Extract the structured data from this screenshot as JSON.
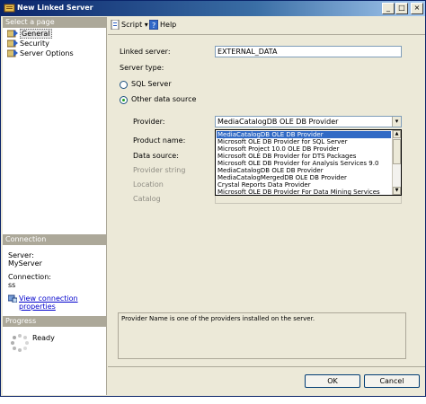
{
  "window": {
    "title": "New Linked Server",
    "controls": {
      "minimize": "_",
      "maximize": "□",
      "close": "×"
    }
  },
  "left": {
    "select_page_header": "Select a page",
    "pages": [
      {
        "label": "General",
        "icon": "page-icon",
        "selected": true
      },
      {
        "label": "Security",
        "icon": "page-icon",
        "selected": false
      },
      {
        "label": "Server Options",
        "icon": "page-icon",
        "selected": false
      }
    ],
    "connection_header": "Connection",
    "server_label": "Server:",
    "server_value": "MyServer",
    "connection_label": "Connection:",
    "connection_value": "ss",
    "view_connection_link": "View connection properties",
    "progress_header": "Progress",
    "progress_status": "Ready"
  },
  "toolbar": {
    "script_label": "Script",
    "script_arrow": "▾",
    "help_label": "Help"
  },
  "form": {
    "linked_server_label": "Linked server:",
    "linked_server_value": "EXTERNAL_DATA",
    "server_type_label": "Server type:",
    "sql_server_label": "SQL Server",
    "other_source_label": "Other data source",
    "provider_label": "Provider:",
    "provider_value": "MediaCatalogDB OLE DB Provider",
    "provider_arrow": "▾",
    "product_name_label": "Product name:",
    "data_source_label": "Data source:",
    "provider_string_label": "Provider string",
    "location_label": "Location",
    "catalog_label": "Catalog",
    "provider_options": [
      "MediaCatalogDB OLE DB Provider",
      "Microsoft OLE DB Provider for SQL Server",
      "Microsoft Project 10.0 OLE DB Provider",
      "Microsoft OLE DB Provider for DTS Packages",
      "Microsoft OLE DB Provider for Analysis Services 9.0",
      "MediaCatalogDB OLE DB Provider",
      "MediaCatalogMergedDB OLE DB Provider",
      "Crystal Reports Data Provider",
      "Microsoft OLE DB Provider For Data Mining Services"
    ],
    "description": "Provider Name is one of the providers installed on the server."
  },
  "buttons": {
    "ok": "OK",
    "cancel": "Cancel"
  },
  "colors": {
    "title_bar": "#0a246a",
    "selection": "#316ac5",
    "link": "#0000cc"
  }
}
